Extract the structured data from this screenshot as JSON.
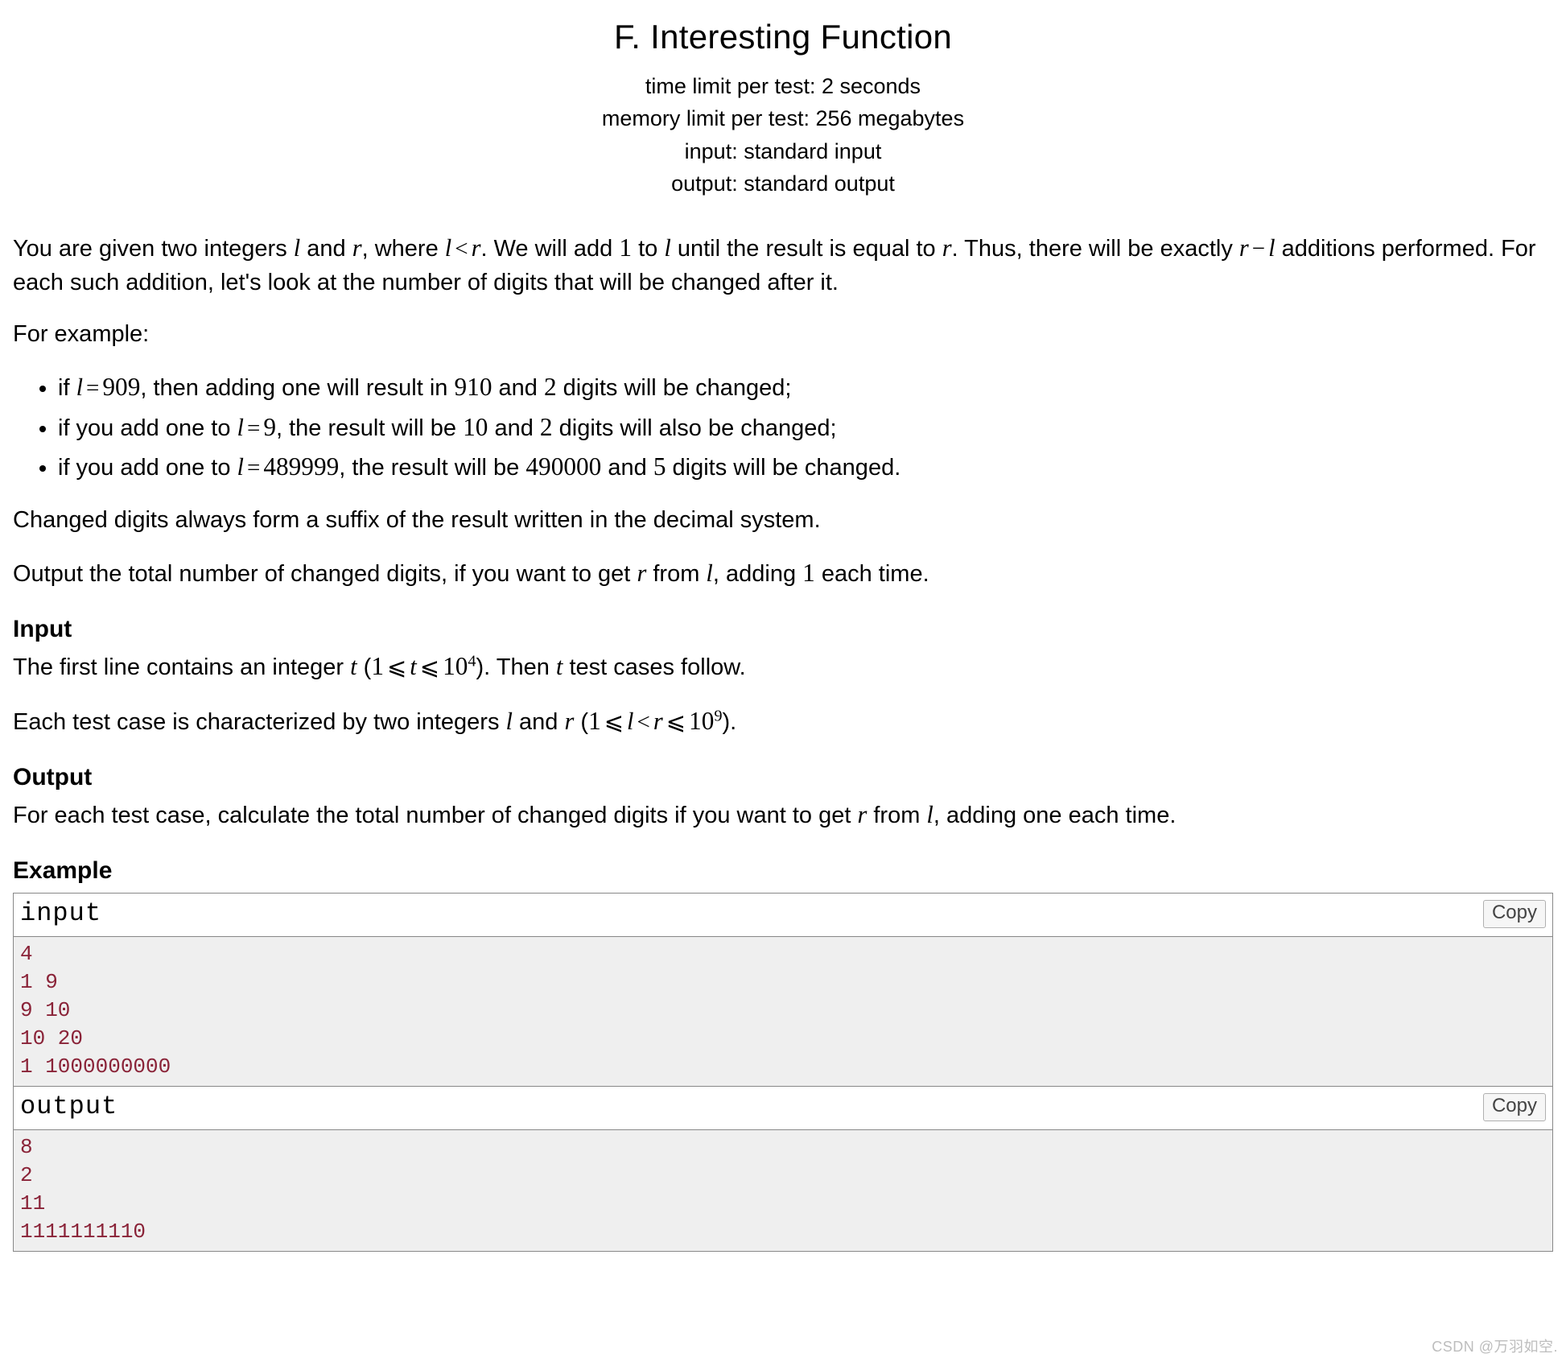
{
  "title": "F. Interesting Function",
  "meta": {
    "time_limit": "time limit per test: 2 seconds",
    "memory_limit": "memory limit per test: 256 megabytes",
    "input": "input: standard input",
    "output": "output: standard output"
  },
  "para": {
    "intro_a": "You are given two integers ",
    "intro_b": " and ",
    "intro_c": ", where ",
    "intro_d": ". We will add ",
    "intro_e": " to ",
    "intro_f": " until the result is equal to ",
    "intro_g": ". Thus, there will be exactly ",
    "intro_h": " additions performed. For each such addition, let's look at the number of digits that will be changed after it.",
    "example_lead": "For example:",
    "suffix_note": "Changed digits always form a suffix of the result written in the decimal system.",
    "task_a": "Output the total number of changed digits, if you want to get ",
    "task_b": " from ",
    "task_c": ", adding ",
    "task_d": " each time.",
    "input_a": "The first line contains an integer ",
    "input_b": " (",
    "input_c": "). Then ",
    "input_d": " test cases follow.",
    "input2_a": "Each test case is characterized by two integers ",
    "input2_b": " and ",
    "input2_c": " (",
    "input2_d": ").",
    "output_a": "For each test case, calculate the total number of changed digits if you want to get ",
    "output_b": " from ",
    "output_c": ", adding one each time."
  },
  "bullets": {
    "b1_a": "if ",
    "b1_b": ", then adding one will result in ",
    "b1_c": " and ",
    "b1_d": " digits will be changed;",
    "b2_a": "if you add one to ",
    "b2_b": ", the result will be ",
    "b2_c": " and ",
    "b2_d": " digits will also be changed;",
    "b3_a": "if you add one to ",
    "b3_b": ", the result will be ",
    "b3_c": " and ",
    "b3_d": " digits will be changed."
  },
  "math": {
    "l": "l",
    "r": "r",
    "t": "t",
    "lt": "<",
    "le": "⩽",
    "eq": "=",
    "minus": "−",
    "one": "1",
    "two": "2",
    "five": "5",
    "n909": "909",
    "n910": "910",
    "n9": "9",
    "n10": "10",
    "n489999": "489999",
    "n490000": "490000",
    "ten": "10",
    "exp4": "4",
    "exp9": "9"
  },
  "sections": {
    "input": "Input",
    "output": "Output",
    "example": "Example"
  },
  "example": {
    "input_label": "input",
    "output_label": "output",
    "copy": "Copy",
    "input_text": "4\n1 9\n9 10\n10 20\n1 1000000000",
    "output_text": "8\n2\n11\n1111111110"
  },
  "watermark": "CSDN @万羽如空."
}
